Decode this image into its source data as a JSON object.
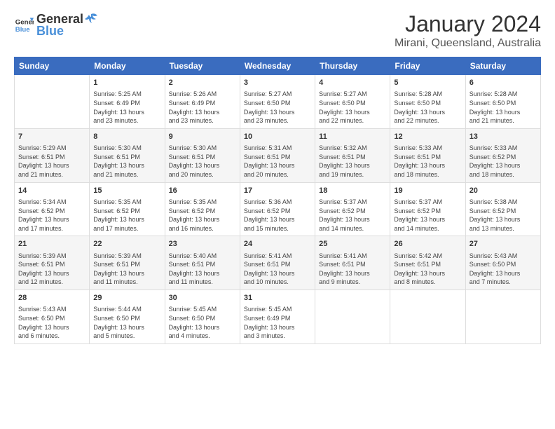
{
  "header": {
    "logo_general": "General",
    "logo_blue": "Blue",
    "month": "January 2024",
    "location": "Mirani, Queensland, Australia"
  },
  "weekdays": [
    "Sunday",
    "Monday",
    "Tuesday",
    "Wednesday",
    "Thursday",
    "Friday",
    "Saturday"
  ],
  "weeks": [
    [
      {
        "day": "",
        "content": ""
      },
      {
        "day": "1",
        "content": "Sunrise: 5:25 AM\nSunset: 6:49 PM\nDaylight: 13 hours\nand 23 minutes."
      },
      {
        "day": "2",
        "content": "Sunrise: 5:26 AM\nSunset: 6:49 PM\nDaylight: 13 hours\nand 23 minutes."
      },
      {
        "day": "3",
        "content": "Sunrise: 5:27 AM\nSunset: 6:50 PM\nDaylight: 13 hours\nand 23 minutes."
      },
      {
        "day": "4",
        "content": "Sunrise: 5:27 AM\nSunset: 6:50 PM\nDaylight: 13 hours\nand 22 minutes."
      },
      {
        "day": "5",
        "content": "Sunrise: 5:28 AM\nSunset: 6:50 PM\nDaylight: 13 hours\nand 22 minutes."
      },
      {
        "day": "6",
        "content": "Sunrise: 5:28 AM\nSunset: 6:50 PM\nDaylight: 13 hours\nand 21 minutes."
      }
    ],
    [
      {
        "day": "7",
        "content": "Sunrise: 5:29 AM\nSunset: 6:51 PM\nDaylight: 13 hours\nand 21 minutes."
      },
      {
        "day": "8",
        "content": "Sunrise: 5:30 AM\nSunset: 6:51 PM\nDaylight: 13 hours\nand 21 minutes."
      },
      {
        "day": "9",
        "content": "Sunrise: 5:30 AM\nSunset: 6:51 PM\nDaylight: 13 hours\nand 20 minutes."
      },
      {
        "day": "10",
        "content": "Sunrise: 5:31 AM\nSunset: 6:51 PM\nDaylight: 13 hours\nand 20 minutes."
      },
      {
        "day": "11",
        "content": "Sunrise: 5:32 AM\nSunset: 6:51 PM\nDaylight: 13 hours\nand 19 minutes."
      },
      {
        "day": "12",
        "content": "Sunrise: 5:33 AM\nSunset: 6:51 PM\nDaylight: 13 hours\nand 18 minutes."
      },
      {
        "day": "13",
        "content": "Sunrise: 5:33 AM\nSunset: 6:52 PM\nDaylight: 13 hours\nand 18 minutes."
      }
    ],
    [
      {
        "day": "14",
        "content": "Sunrise: 5:34 AM\nSunset: 6:52 PM\nDaylight: 13 hours\nand 17 minutes."
      },
      {
        "day": "15",
        "content": "Sunrise: 5:35 AM\nSunset: 6:52 PM\nDaylight: 13 hours\nand 17 minutes."
      },
      {
        "day": "16",
        "content": "Sunrise: 5:35 AM\nSunset: 6:52 PM\nDaylight: 13 hours\nand 16 minutes."
      },
      {
        "day": "17",
        "content": "Sunrise: 5:36 AM\nSunset: 6:52 PM\nDaylight: 13 hours\nand 15 minutes."
      },
      {
        "day": "18",
        "content": "Sunrise: 5:37 AM\nSunset: 6:52 PM\nDaylight: 13 hours\nand 14 minutes."
      },
      {
        "day": "19",
        "content": "Sunrise: 5:37 AM\nSunset: 6:52 PM\nDaylight: 13 hours\nand 14 minutes."
      },
      {
        "day": "20",
        "content": "Sunrise: 5:38 AM\nSunset: 6:52 PM\nDaylight: 13 hours\nand 13 minutes."
      }
    ],
    [
      {
        "day": "21",
        "content": "Sunrise: 5:39 AM\nSunset: 6:51 PM\nDaylight: 13 hours\nand 12 minutes."
      },
      {
        "day": "22",
        "content": "Sunrise: 5:39 AM\nSunset: 6:51 PM\nDaylight: 13 hours\nand 11 minutes."
      },
      {
        "day": "23",
        "content": "Sunrise: 5:40 AM\nSunset: 6:51 PM\nDaylight: 13 hours\nand 11 minutes."
      },
      {
        "day": "24",
        "content": "Sunrise: 5:41 AM\nSunset: 6:51 PM\nDaylight: 13 hours\nand 10 minutes."
      },
      {
        "day": "25",
        "content": "Sunrise: 5:41 AM\nSunset: 6:51 PM\nDaylight: 13 hours\nand 9 minutes."
      },
      {
        "day": "26",
        "content": "Sunrise: 5:42 AM\nSunset: 6:51 PM\nDaylight: 13 hours\nand 8 minutes."
      },
      {
        "day": "27",
        "content": "Sunrise: 5:43 AM\nSunset: 6:50 PM\nDaylight: 13 hours\nand 7 minutes."
      }
    ],
    [
      {
        "day": "28",
        "content": "Sunrise: 5:43 AM\nSunset: 6:50 PM\nDaylight: 13 hours\nand 6 minutes."
      },
      {
        "day": "29",
        "content": "Sunrise: 5:44 AM\nSunset: 6:50 PM\nDaylight: 13 hours\nand 5 minutes."
      },
      {
        "day": "30",
        "content": "Sunrise: 5:45 AM\nSunset: 6:50 PM\nDaylight: 13 hours\nand 4 minutes."
      },
      {
        "day": "31",
        "content": "Sunrise: 5:45 AM\nSunset: 6:49 PM\nDaylight: 13 hours\nand 3 minutes."
      },
      {
        "day": "",
        "content": ""
      },
      {
        "day": "",
        "content": ""
      },
      {
        "day": "",
        "content": ""
      }
    ]
  ]
}
